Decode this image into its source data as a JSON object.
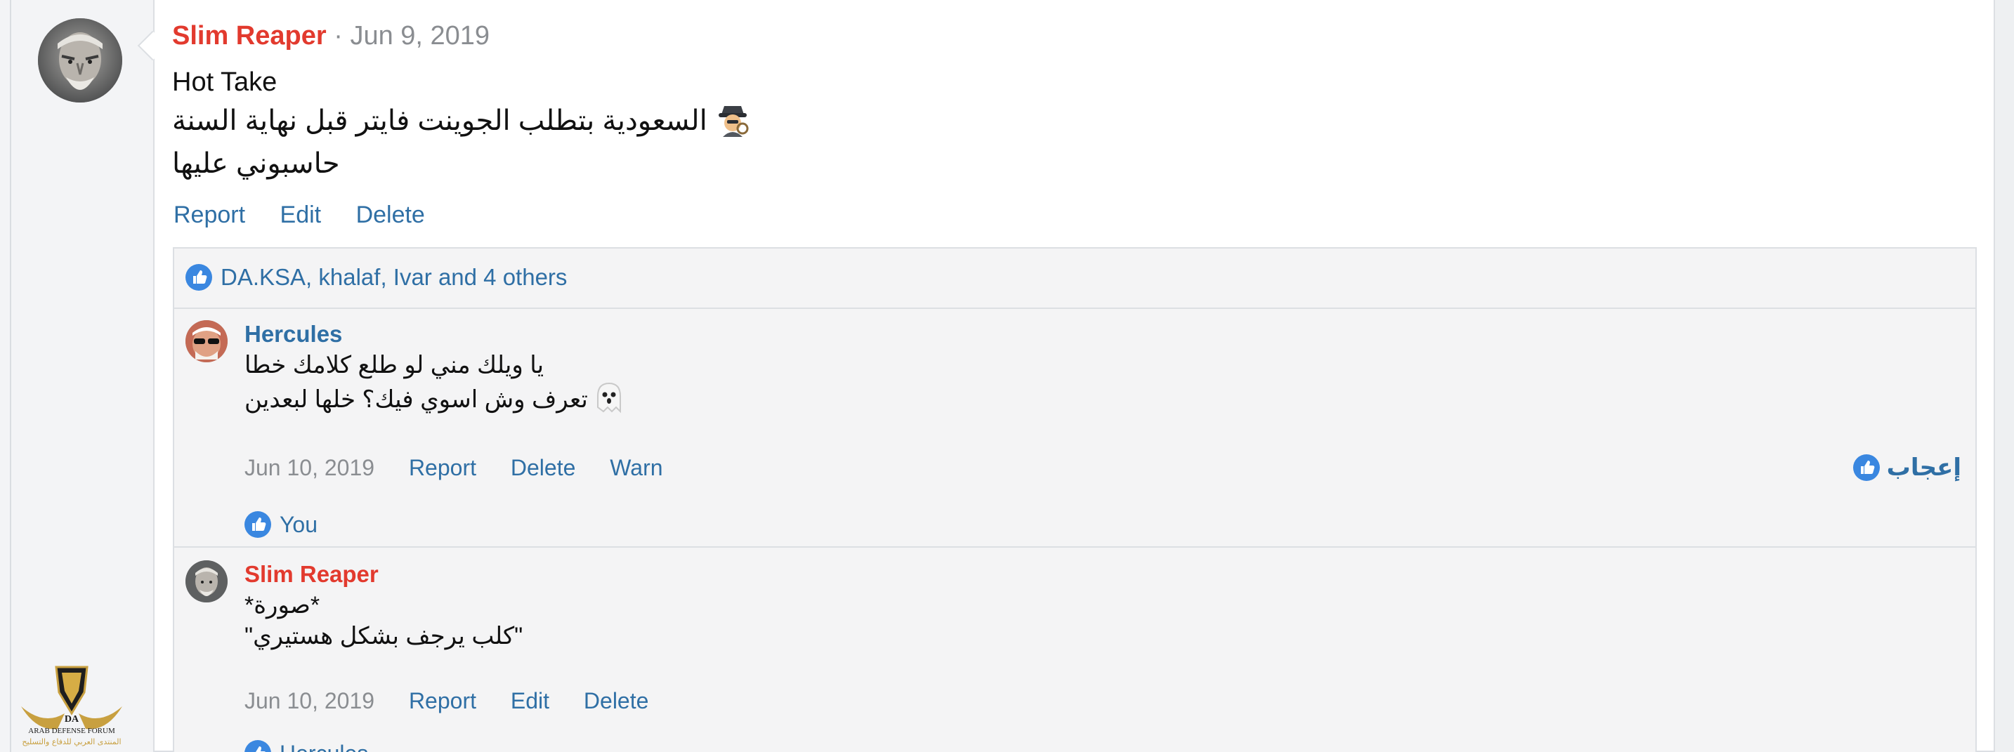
{
  "post": {
    "author": "Slim Reaper",
    "separator": "·",
    "date": "Jun 9, 2019",
    "title": "Hot Take",
    "line1": "السعودية بتطلب الجوينت فايتر قبل نهاية السنة",
    "line1_icon": "detective-emoji",
    "line2": "حاسبوني عليها",
    "actions": {
      "report": "Report",
      "edit": "Edit",
      "delete": "Delete"
    },
    "likes": "DA.KSA, khalaf, Ivar and 4 others"
  },
  "comments": [
    {
      "author": "Hercules",
      "author_color": "#2f6fa5",
      "line1": "يا ويلك مني لو طلع كلامك خطا",
      "line2": "تعرف وش اسوي فيك؟ خلها لبعدين",
      "line2_icon": "ghost-emoji",
      "date": "Jun 10, 2019",
      "actions": {
        "report": "Report",
        "delete": "Delete",
        "warn": "Warn"
      },
      "like_action": "إعجاب",
      "likes": "You"
    },
    {
      "author": "Slim Reaper",
      "author_color": "#e23a2e",
      "line1": "*صورة*",
      "line2": "\"كلب يرجف بشكل هستيري\"",
      "date": "Jun 10, 2019",
      "actions": {
        "report": "Report",
        "edit": "Edit",
        "delete": "Delete"
      },
      "likes": "Hercules"
    }
  ],
  "sidebar": {
    "logo_line1": "DA",
    "logo_line2": "ARAB DEFENSE FORUM",
    "logo_line3": "المنتدى العربي للدفاع والتسليح"
  },
  "colors": {
    "author_red": "#e23a2e",
    "link_blue": "#2f6fa5",
    "like_blue": "#3a87e0",
    "meta_grey": "#8a8d91"
  }
}
